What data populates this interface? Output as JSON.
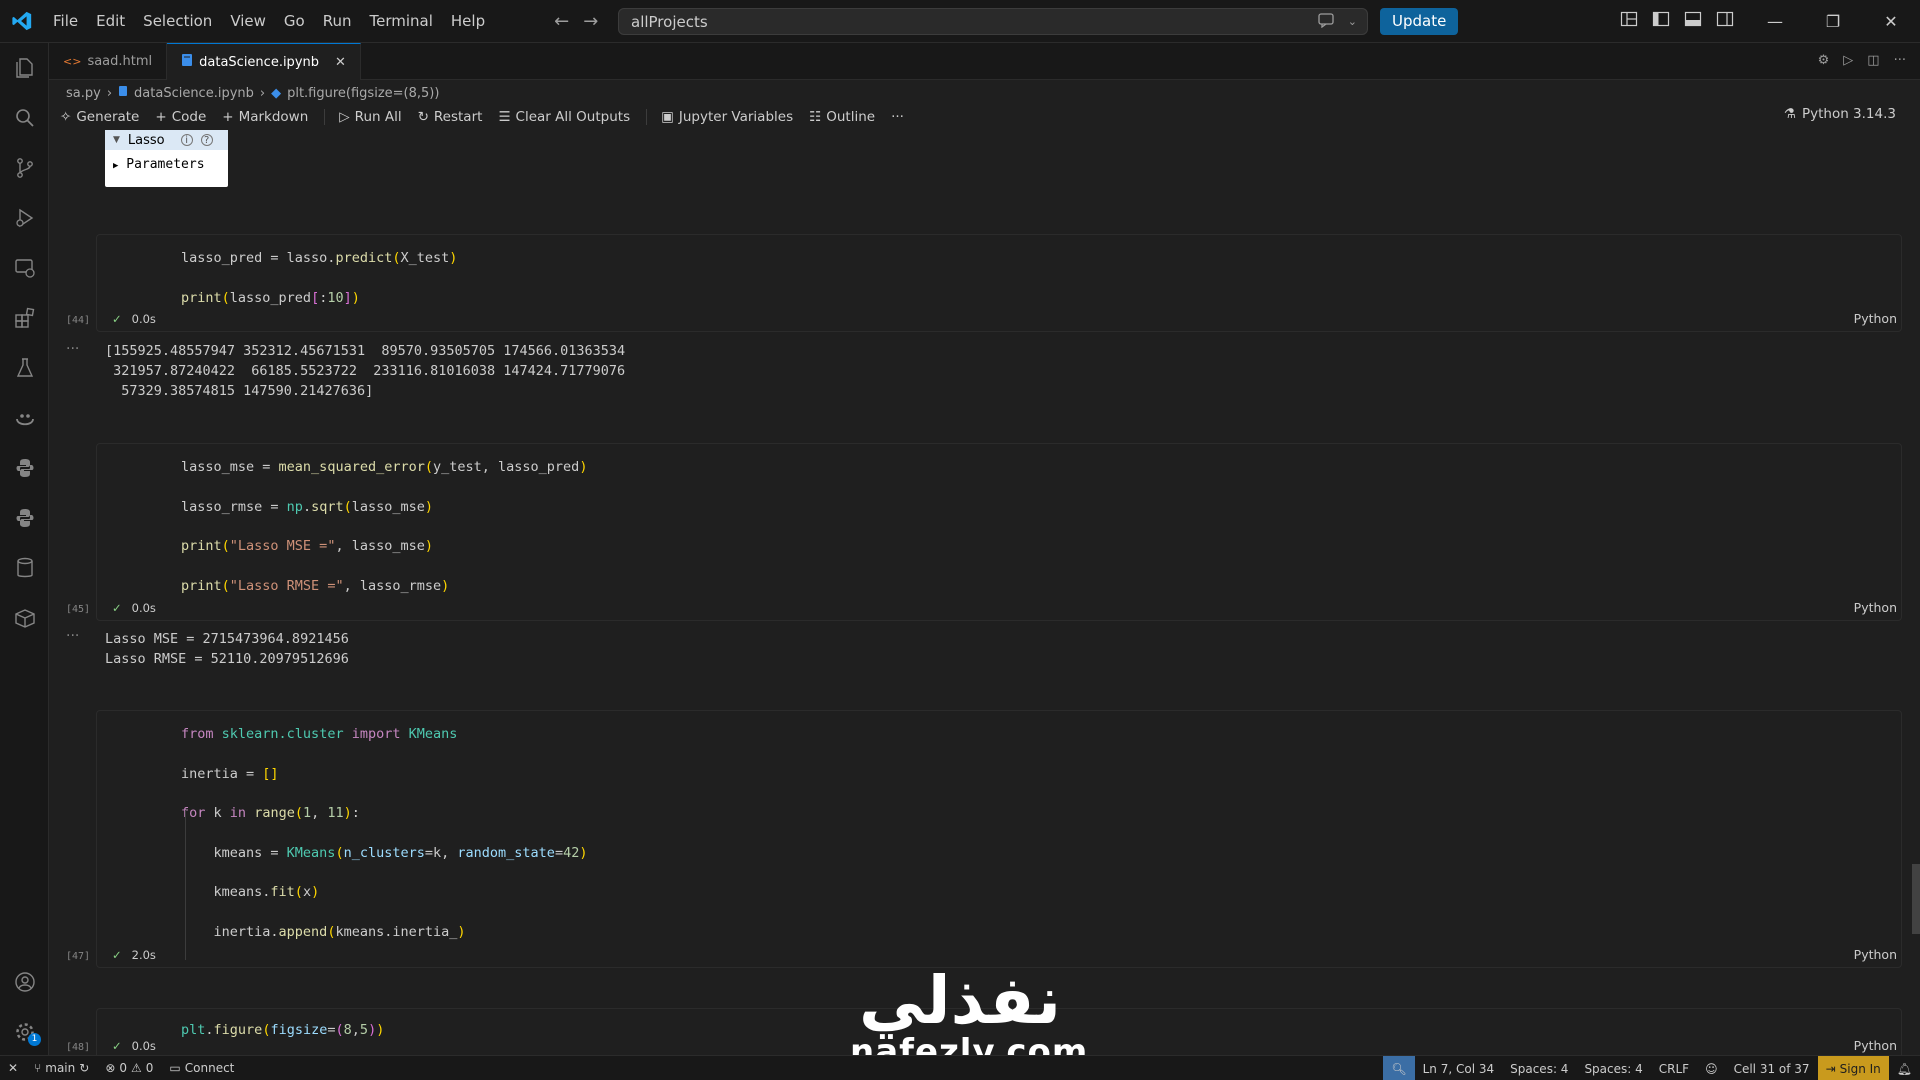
{
  "menu": [
    "File",
    "Edit",
    "Selection",
    "View",
    "Go",
    "Run",
    "Terminal",
    "Help"
  ],
  "search": {
    "value": "allProjects"
  },
  "update_label": "Update",
  "tabs": [
    {
      "label": "saad.html",
      "icon": "html-file-icon"
    },
    {
      "label": "dataScience.ipynb",
      "icon": "notebook-file-icon",
      "active": true
    }
  ],
  "breadcrumb": [
    "sa.py",
    "dataScience.ipynb",
    "plt.figure(figsize=(8,5))"
  ],
  "toolbar": {
    "generate": "Generate",
    "code": "Code",
    "markdown": "Markdown",
    "run_all": "Run All",
    "restart": "Restart",
    "clear_outputs": "Clear All Outputs",
    "variables": "Jupyter Variables",
    "outline": "Outline",
    "more": "···",
    "kernel": "Python 3.14.3"
  },
  "widget": {
    "title": "Lasso",
    "params": "Parameters"
  },
  "cells": [
    {
      "exec": "[44]",
      "time": "0.0s",
      "lang": "Python",
      "output": [
        "[155925.48557947 352312.45671531  89570.93505705 174566.01363534",
        " 321957.87240422  66185.5523722  233116.81016038 147424.71779076",
        "  57329.38574815 147590.21427636]"
      ]
    },
    {
      "exec": "[45]",
      "time": "0.0s",
      "lang": "Python",
      "output": [
        "Lasso MSE = 2715473964.8921456",
        "Lasso RMSE = 52110.20979512696"
      ]
    },
    {
      "exec": "[47]",
      "time": "2.0s",
      "lang": "Python"
    },
    {
      "exec": "[48]",
      "time": "0.0s",
      "lang": "Python"
    }
  ],
  "status": {
    "branch": "main",
    "errors": "0",
    "warnings": "0",
    "connect": "Connect",
    "position": "Ln 7, Col 34",
    "spaces1": "Spaces: 4",
    "spaces2": "Spaces: 4",
    "eol": "CRLF",
    "cell": "Cell 31 of 37",
    "signin": "Sign In",
    "settings_badge": "1"
  },
  "watermark": {
    "arabic": "نفذلي",
    "latin": "nafezly.com"
  }
}
